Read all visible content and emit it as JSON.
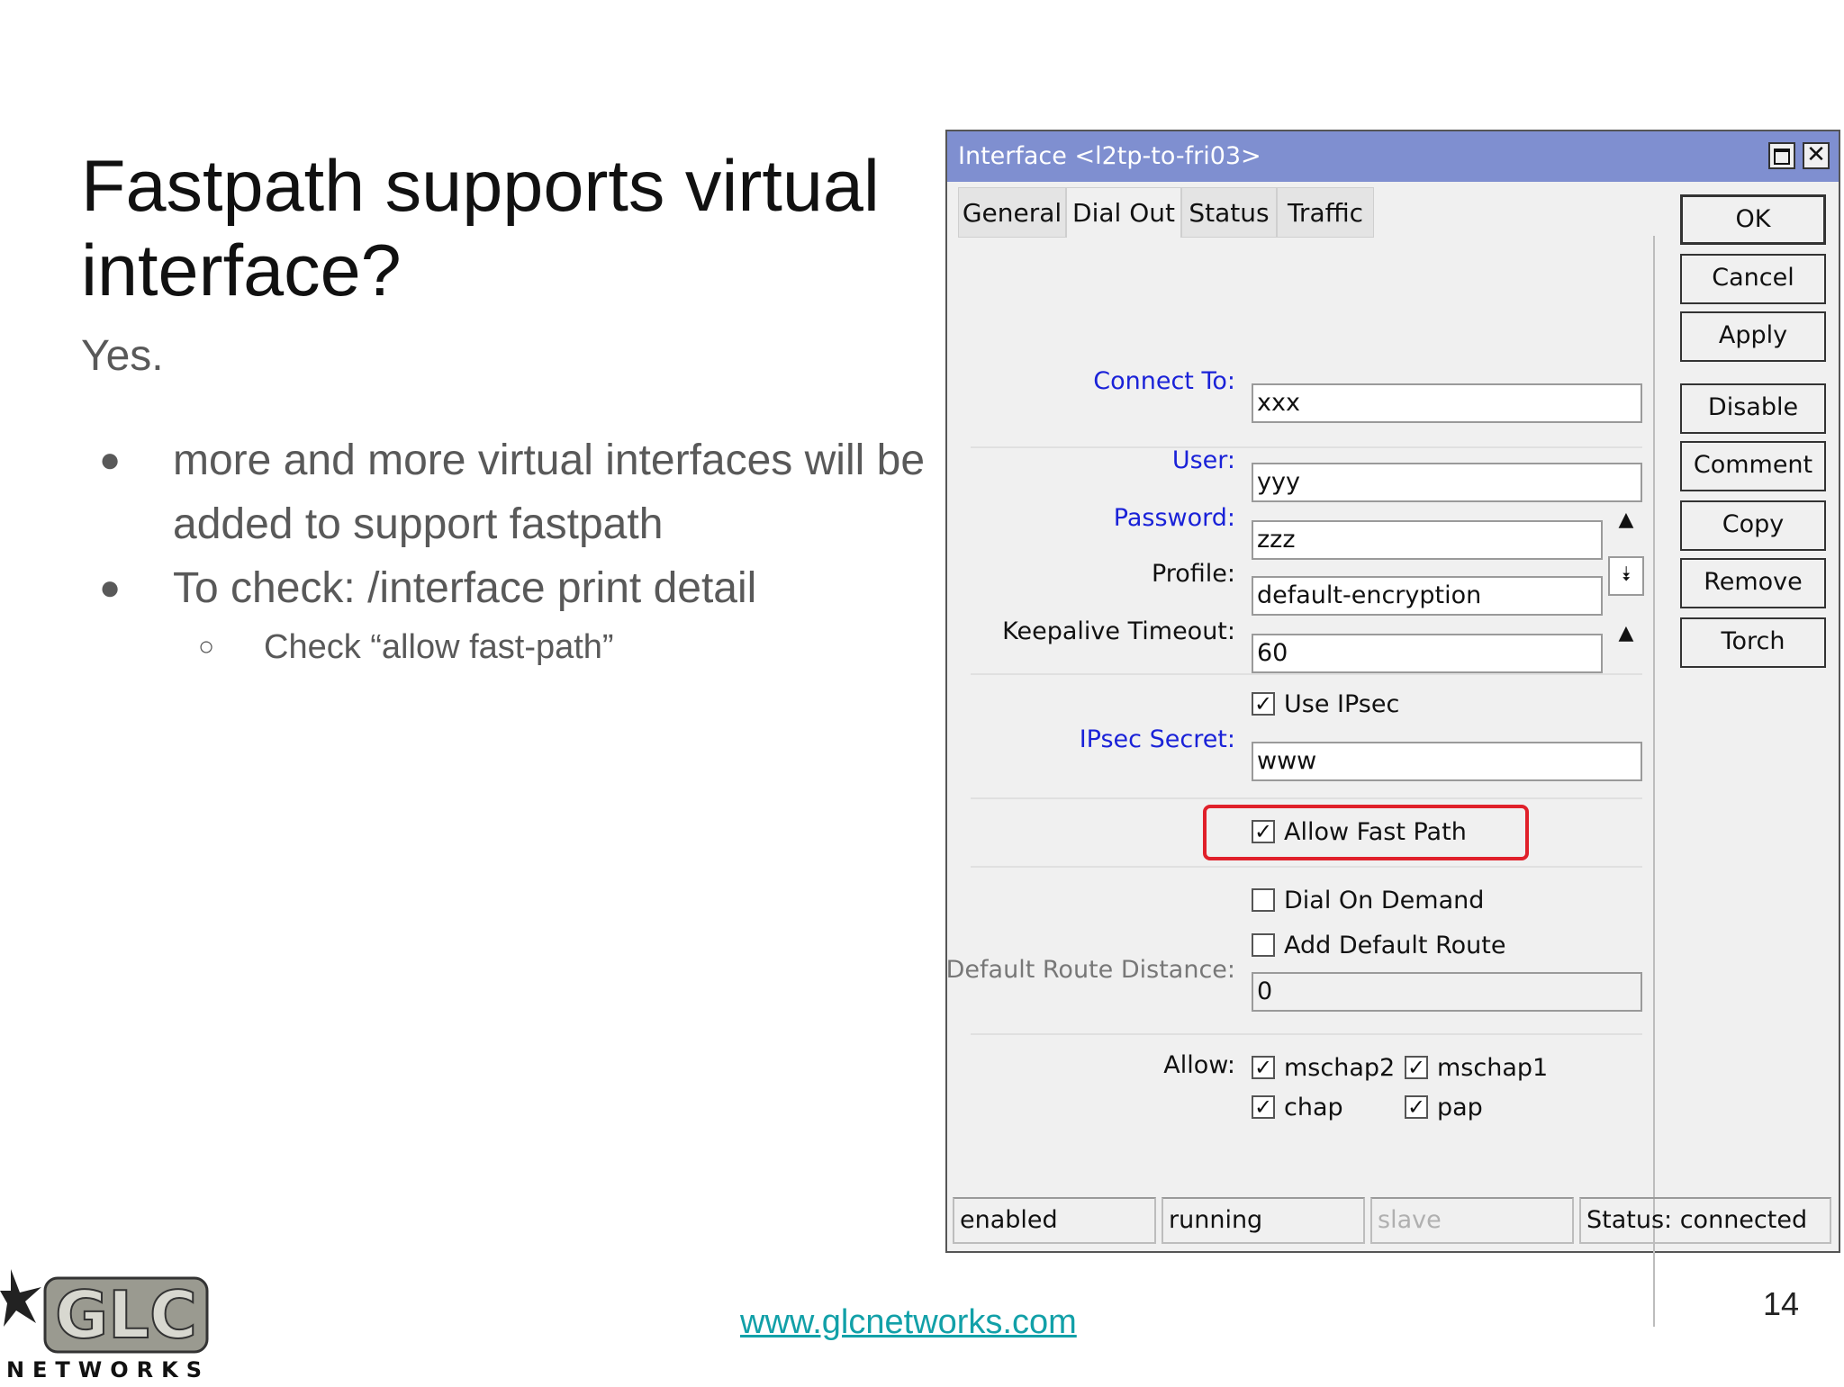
{
  "slide": {
    "title": "Fastpath supports virtual interface?",
    "subtitle": "Yes.",
    "bullets": [
      "more and more virtual interfaces will be added to support fastpath",
      "To check: /interface print detail"
    ],
    "sub_bullet": "Check “allow fast-path”",
    "footer_link": "www.glcnetworks.com",
    "page_number": "14",
    "logo": {
      "text": "GLC",
      "subtext": "NETWORKS"
    }
  },
  "window": {
    "title": "Interface <l2tp-to-fri03>",
    "tabs": [
      "General",
      "Dial Out",
      "Status",
      "Traffic"
    ],
    "active_tab": "Dial Out",
    "fields": {
      "connect_to": {
        "label": "Connect To:",
        "value": "xxx"
      },
      "user": {
        "label": "User:",
        "value": "yyy"
      },
      "password": {
        "label": "Password:",
        "value": "zzz"
      },
      "profile": {
        "label": "Profile:",
        "value": "default-encryption"
      },
      "keepalive": {
        "label": "Keepalive Timeout:",
        "value": "60"
      },
      "ipsec_secret": {
        "label": "IPsec Secret:",
        "value": "www"
      },
      "default_route_distance": {
        "label": "Default Route Distance:",
        "value": "0"
      }
    },
    "checkboxes": {
      "use_ipsec": {
        "label": "Use IPsec",
        "checked": true
      },
      "allow_fast_path": {
        "label": "Allow Fast Path",
        "checked": true
      },
      "dial_on_demand": {
        "label": "Dial On Demand",
        "checked": false
      },
      "add_default_route": {
        "label": "Add Default Route",
        "checked": false
      }
    },
    "allow": {
      "label": "Allow:",
      "options": [
        {
          "label": "mschap2",
          "checked": true
        },
        {
          "label": "mschap1",
          "checked": true
        },
        {
          "label": "chap",
          "checked": true
        },
        {
          "label": "pap",
          "checked": true
        }
      ]
    },
    "buttons": [
      "OK",
      "Cancel",
      "Apply",
      "Disable",
      "Comment",
      "Copy",
      "Remove",
      "Torch"
    ],
    "status_bar": [
      "enabled",
      "running",
      "slave",
      "Status: connected"
    ],
    "colors": {
      "titlebar": "#7f8fd0",
      "highlight": "#e0202a",
      "label_blue": "#1a22d8",
      "link": "#12a0a8"
    }
  }
}
